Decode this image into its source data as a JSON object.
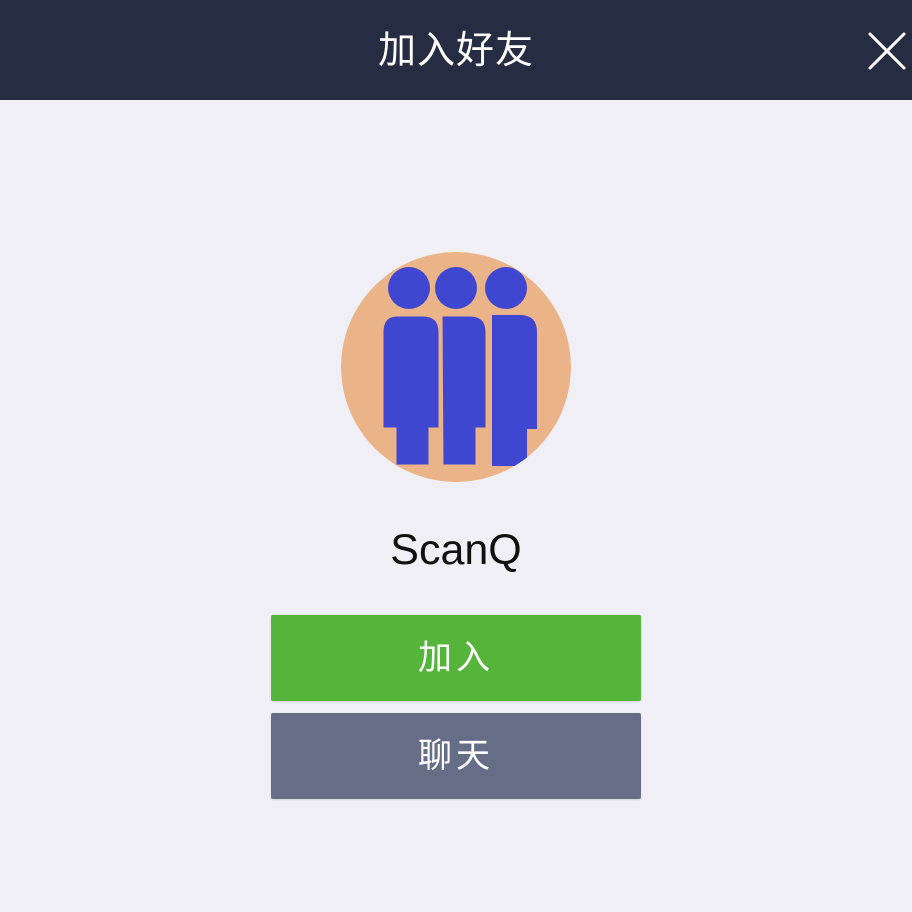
{
  "header": {
    "title": "加入好友",
    "close_icon": "close-icon",
    "background": "#262d42"
  },
  "profile": {
    "name": "ScanQ",
    "avatar_icon": "group-of-people-avatar",
    "avatar_background": "#ebb488",
    "avatar_figure_color": "#3f47d0"
  },
  "actions": {
    "add_label": "加入",
    "add_color": "#55b43a",
    "chat_label": "聊天",
    "chat_color": "#666d86"
  }
}
